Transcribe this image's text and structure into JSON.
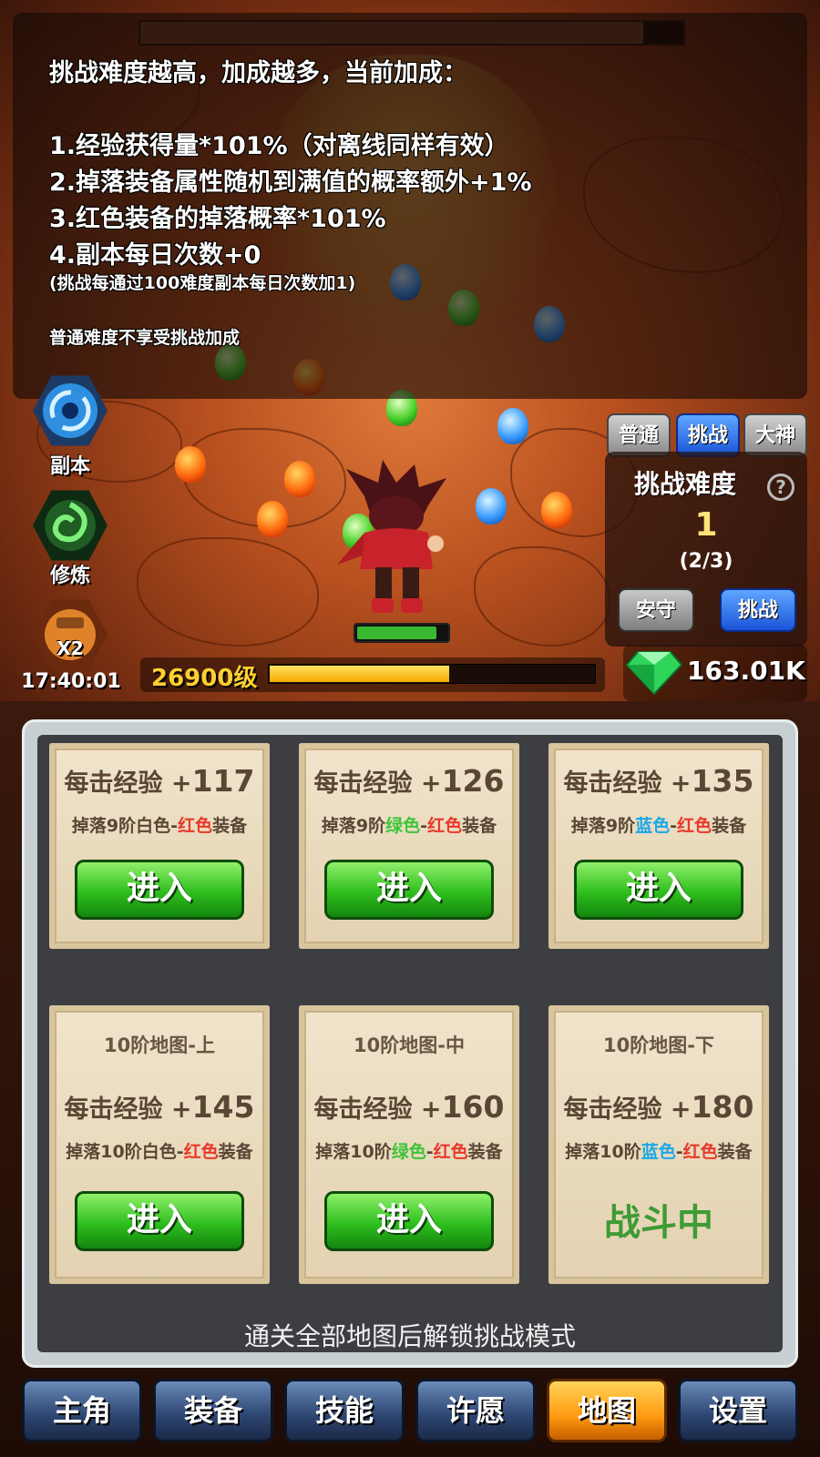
{
  "info": {
    "header": "挑战难度越高，加成越多，当前加成：",
    "line1": "1.经验获得量*101%（对离线同样有效）",
    "line2": "2.掉落装备属性随机到满值的概率额外+1%",
    "line3": "3.红色装备的掉落概率*101%",
    "line4": "4.副本每日次数+0",
    "note": "(挑战每通过100难度副本每日次数加1)",
    "footer": "普通难度不享受挑战加成"
  },
  "side": {
    "dungeon_label": "副本",
    "train_label": "修炼",
    "boost_label": "X2",
    "timer": "17:40:01"
  },
  "hero": {
    "hp_fraction": 0.85
  },
  "level": {
    "label": "26900级",
    "xp_fraction": 0.55
  },
  "currency": {
    "gems": "163.01K"
  },
  "mode": {
    "tab_normal": "普通",
    "tab_challenge": "挑战",
    "tab_master": "大神",
    "title": "挑战难度",
    "help": "?",
    "value": "1",
    "count": "(2/3)",
    "safe_btn": "安守",
    "challenge_btn": "挑战"
  },
  "cards": [
    {
      "exp_label": "每击经验 +",
      "exp_value": "117",
      "drop_pre": "掉落9阶",
      "drop_c1": "白色",
      "drop_sep": "-",
      "drop_c2": "红色",
      "drop_post": "装备",
      "action": "进入"
    },
    {
      "exp_label": "每击经验 +",
      "exp_value": "126",
      "drop_pre": "掉落9阶",
      "drop_c1": "绿色",
      "drop_sep": "-",
      "drop_c2": "红色",
      "drop_post": "装备",
      "action": "进入"
    },
    {
      "exp_label": "每击经验 +",
      "exp_value": "135",
      "drop_pre": "掉落9阶",
      "drop_c1": "蓝色",
      "drop_sep": "-",
      "drop_c2": "红色",
      "drop_post": "装备",
      "action": "进入"
    },
    {
      "map": "10阶地图-上",
      "exp_label": "每击经验 +",
      "exp_value": "145",
      "drop_pre": "掉落10阶",
      "drop_c1": "白色",
      "drop_sep": "-",
      "drop_c2": "红色",
      "drop_post": "装备",
      "action": "进入"
    },
    {
      "map": "10阶地图-中",
      "exp_label": "每击经验 +",
      "exp_value": "160",
      "drop_pre": "掉落10阶",
      "drop_c1": "绿色",
      "drop_sep": "-",
      "drop_c2": "红色",
      "drop_post": "装备",
      "action": "进入"
    },
    {
      "map": "10阶地图-下",
      "exp_label": "每击经验 +",
      "exp_value": "180",
      "drop_pre": "掉落10阶",
      "drop_c1": "蓝色",
      "drop_sep": "-",
      "drop_c2": "红色",
      "drop_post": "装备",
      "status": "战斗中"
    }
  ],
  "unlock_note": "通关全部地图后解锁挑战模式",
  "nav": [
    "主角",
    "装备",
    "技能",
    "许愿",
    "地图",
    "设置"
  ],
  "colors": {
    "accent_gold": "#ffd030",
    "nav_active": "#ff9a10",
    "enter_green": "#2fbe1e",
    "challenge_blue": "#1a54d8"
  }
}
